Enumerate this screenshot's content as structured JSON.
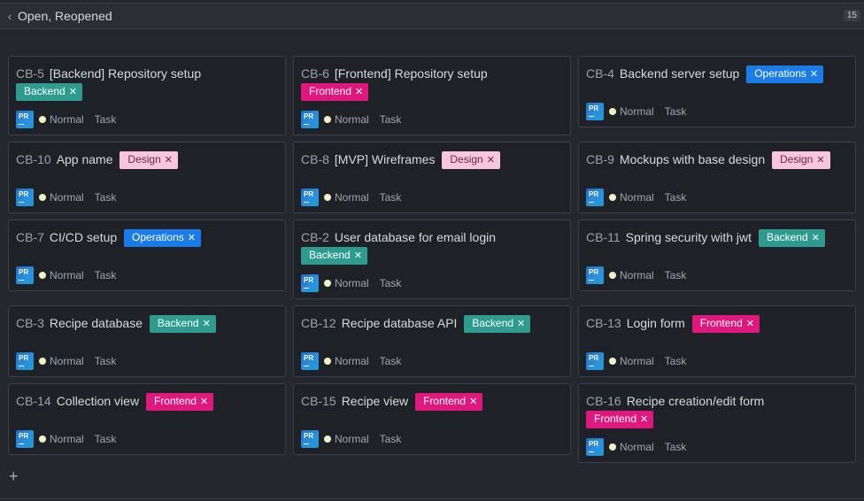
{
  "group": {
    "title": "Open, Reopened",
    "count": "15"
  },
  "colors": {
    "backend": "#2d9c8f",
    "frontend": "#e0187d",
    "operations": "#1a7ce8",
    "design": "#f7c6dc"
  },
  "avatar_text": "PR",
  "cards": [
    {
      "key": "CB-5",
      "title": "[Backend] Repository setup",
      "tag": "Backend",
      "tag_class": "t-backend",
      "priority": "Normal",
      "type": "Task"
    },
    {
      "key": "CB-6",
      "title": "[Frontend] Repository setup",
      "tag": "Frontend",
      "tag_class": "t-frontend",
      "priority": "Normal",
      "type": "Task"
    },
    {
      "key": "CB-4",
      "title": "Backend server setup",
      "tag": "Operations",
      "tag_class": "t-operations",
      "priority": "Normal",
      "type": "Task"
    },
    {
      "key": "CB-10",
      "title": "App name",
      "tag": "Design",
      "tag_class": "t-design",
      "priority": "Normal",
      "type": "Task"
    },
    {
      "key": "CB-8",
      "title": "[MVP] Wireframes",
      "tag": "Design",
      "tag_class": "t-design",
      "priority": "Normal",
      "type": "Task"
    },
    {
      "key": "CB-9",
      "title": "Mockups with base design",
      "tag": "Design",
      "tag_class": "t-design",
      "priority": "Normal",
      "type": "Task"
    },
    {
      "key": "CB-7",
      "title": "CI/CD setup",
      "tag": "Operations",
      "tag_class": "t-operations",
      "priority": "Normal",
      "type": "Task"
    },
    {
      "key": "CB-2",
      "title": "User database for email login",
      "tag": "Backend",
      "tag_class": "t-backend",
      "priority": "Normal",
      "type": "Task"
    },
    {
      "key": "CB-11",
      "title": "Spring security with jwt",
      "tag": "Backend",
      "tag_class": "t-backend",
      "priority": "Normal",
      "type": "Task"
    },
    {
      "key": "CB-3",
      "title": "Recipe database",
      "tag": "Backend",
      "tag_class": "t-backend",
      "priority": "Normal",
      "type": "Task"
    },
    {
      "key": "CB-12",
      "title": "Recipe database API",
      "tag": "Backend",
      "tag_class": "t-backend",
      "priority": "Normal",
      "type": "Task"
    },
    {
      "key": "CB-13",
      "title": "Login form",
      "tag": "Frontend",
      "tag_class": "t-frontend",
      "priority": "Normal",
      "type": "Task"
    },
    {
      "key": "CB-14",
      "title": "Collection view",
      "tag": "Frontend",
      "tag_class": "t-frontend",
      "priority": "Normal",
      "type": "Task"
    },
    {
      "key": "CB-15",
      "title": "Recipe view",
      "tag": "Frontend",
      "tag_class": "t-frontend",
      "priority": "Normal",
      "type": "Task"
    },
    {
      "key": "CB-16",
      "title": "Recipe creation/edit form",
      "tag": "Frontend",
      "tag_class": "t-frontend",
      "priority": "Normal",
      "type": "Task"
    }
  ],
  "icons": {
    "collapse": "chevron-left-icon",
    "add": "plus-icon",
    "remove_tag": "close-icon"
  }
}
